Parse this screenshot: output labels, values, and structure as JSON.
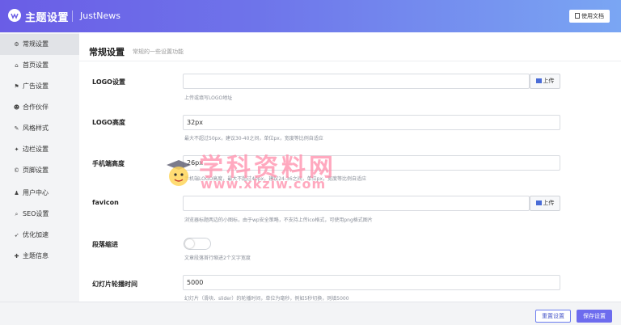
{
  "header": {
    "title": "主题设置",
    "brand": "JustNews",
    "doc_button": "使用文档"
  },
  "sidebar": {
    "items": [
      {
        "label": "常规设置",
        "icon": "gear-icon",
        "glyph": "⚙",
        "active": true
      },
      {
        "label": "首页设置",
        "icon": "home-icon",
        "glyph": "⌂"
      },
      {
        "label": "广告设置",
        "icon": "flag-icon",
        "glyph": "⚑"
      },
      {
        "label": "合作伙伴",
        "icon": "users-icon",
        "glyph": "☻"
      },
      {
        "label": "风格样式",
        "icon": "brush-icon",
        "glyph": "✎"
      },
      {
        "label": "边栏设置",
        "icon": "puzzle-icon",
        "glyph": "✦"
      },
      {
        "label": "页脚设置",
        "icon": "copyright-icon",
        "glyph": "©"
      },
      {
        "label": "用户中心",
        "icon": "user-icon",
        "glyph": "♟"
      },
      {
        "label": "SEO设置",
        "icon": "search-icon",
        "glyph": "⌕"
      },
      {
        "label": "优化加速",
        "icon": "rocket-icon",
        "glyph": "➶"
      },
      {
        "label": "主题信息",
        "icon": "wrench-icon",
        "glyph": "✚"
      }
    ]
  },
  "main": {
    "title": "常规设置",
    "subtitle": "常规的一些设置功能",
    "fields": {
      "logo": {
        "label": "LOGO设置",
        "value": "",
        "upload": "上传",
        "help": "上传或填写LOGO地址"
      },
      "logo_height": {
        "label": "LOGO高度",
        "value": "32px",
        "help": "最大不超过50px，建议30-40之间，单位px，宽度等比例自适应"
      },
      "mobile_height": {
        "label": "手机端高度",
        "value": "26px",
        "help": "手机端LOGO高度，最大不超过40px，建议24-36之间，单位px，宽度等比例自适应"
      },
      "favicon": {
        "label": "favicon",
        "value": "",
        "upload": "上传",
        "help": "浏览器标题两边的小图标，由于wp安全策略，不支持上传ico格式，可使用png格式图片"
      },
      "indent": {
        "label": "段落缩进",
        "enabled": false,
        "help": "文章段落首行缩进2个文字宽度"
      },
      "slider": {
        "label": "幻灯片轮播时间",
        "value": "5000",
        "help": "幻灯片（滑块、slider）的轮播时间，单位为毫秒，例如5秒切换，则填5000"
      }
    }
  },
  "footer": {
    "reset": "重置设置",
    "save": "保存设置"
  },
  "watermark": {
    "text": "学科资料网",
    "url": "www.xkziw.com"
  },
  "colors": {
    "header_start": "#6a5de6",
    "header_end": "#7aa6f3",
    "accent": "#6d6cee"
  }
}
